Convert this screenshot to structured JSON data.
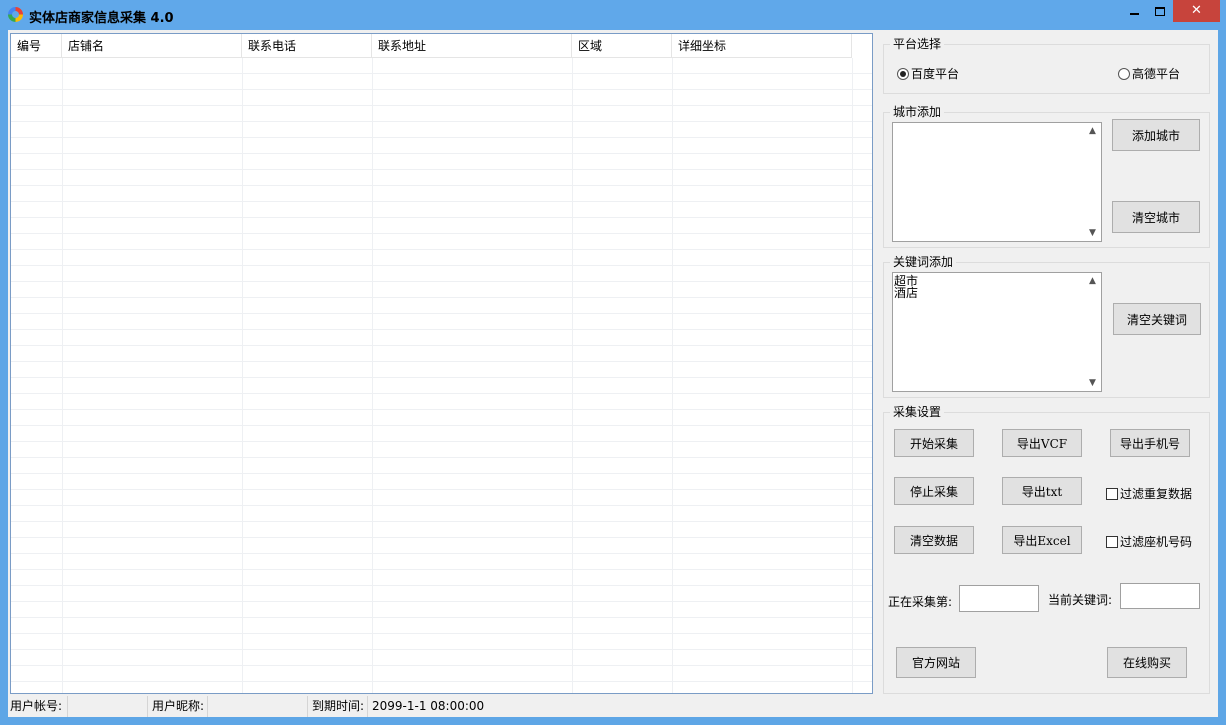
{
  "window": {
    "title": "实体店商家信息采集 4.0",
    "close_glyph": "✕"
  },
  "grid": {
    "columns": [
      "编号",
      "店铺名",
      "联系电话",
      "联系地址",
      "区域",
      "详细坐标"
    ]
  },
  "platform": {
    "title": "平台选择",
    "options": [
      "百度平台",
      "高德平台"
    ],
    "selected": "百度平台"
  },
  "city": {
    "title": "城市添加",
    "value": "",
    "add_label": "添加城市",
    "clear_label": "清空城市"
  },
  "keyword": {
    "title": "关键词添加",
    "value": "超市\n酒店",
    "clear_label": "清空关键词"
  },
  "collect": {
    "title": "采集设置",
    "start_label": "开始采集",
    "stop_label": "停止采集",
    "clear_data_label": "清空数据",
    "export_vcf_label": "导出VCF",
    "export_txt_label": "导出txt",
    "export_excel_label": "导出Excel",
    "export_phone_label": "导出手机号",
    "filter_duplicates_label": "过滤重复数据",
    "filter_landline_label": "过滤座机号码",
    "current_page_label": "正在采集第:",
    "current_keyword_label": "当前关键词:",
    "official_site_label": "官方网站",
    "buy_online_label": "在线购买"
  },
  "status": {
    "account_label": "用户帐号:",
    "account_value": "",
    "nickname_label": "用户昵称:",
    "nickname_value": "",
    "expire_label": "到期时间:",
    "expire_value": "2099-1-1 08:00:00"
  }
}
